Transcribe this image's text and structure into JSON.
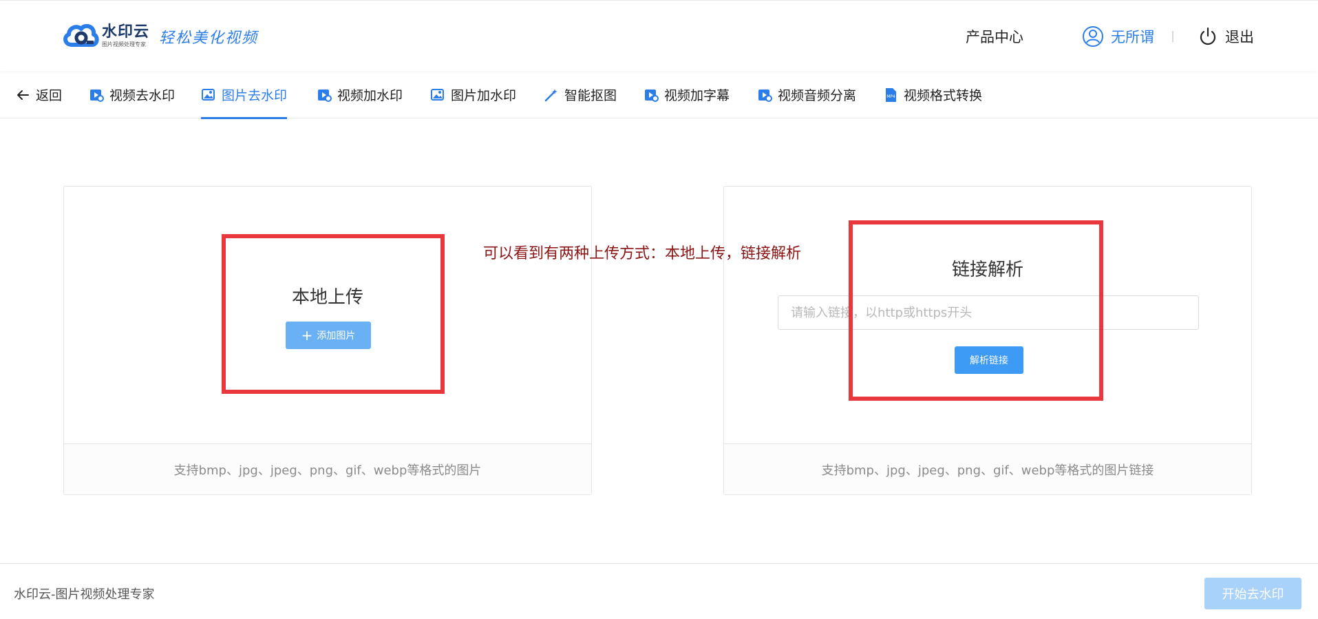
{
  "brand": {
    "name": "水印云",
    "subtitle": "图片视频处理专家",
    "slogan": "轻松美化视频",
    "colors": {
      "primary": "#2b7de9",
      "button": "#3d9bf6",
      "highlight": "#e8383d"
    }
  },
  "header": {
    "product_center": "产品中心",
    "username": "无所谓",
    "logout": "退出"
  },
  "tabs": {
    "back": "返回",
    "items": [
      {
        "label": "视频去水印",
        "icon": "video-icon"
      },
      {
        "label": "图片去水印",
        "icon": "image-icon",
        "active": true
      },
      {
        "label": "视频加水印",
        "icon": "video-icon"
      },
      {
        "label": "图片加水印",
        "icon": "image-icon"
      },
      {
        "label": "智能抠图",
        "icon": "magic-wand-icon"
      },
      {
        "label": "视频加字幕",
        "icon": "video-icon"
      },
      {
        "label": "视频音频分离",
        "icon": "video-icon"
      },
      {
        "label": "视频格式转换",
        "icon": "mp4-file-icon"
      }
    ]
  },
  "local_upload": {
    "title": "本地上传",
    "button": "添加图片",
    "footnote": "支持bmp、jpg、jpeg、png、gif、webp等格式的图片"
  },
  "link_parse": {
    "title": "链接解析",
    "input_placeholder": "请输入链接，以http或https开头",
    "input_value": "",
    "button": "解析链接",
    "footnote": "支持bmp、jpg、jpeg、png、gif、webp等格式的图片链接"
  },
  "annotation": {
    "text": "可以看到有两种上传方式：本地上传，链接解析"
  },
  "footer": {
    "text": "水印云-图片视频处理专家",
    "start_button": "开始去水印"
  }
}
